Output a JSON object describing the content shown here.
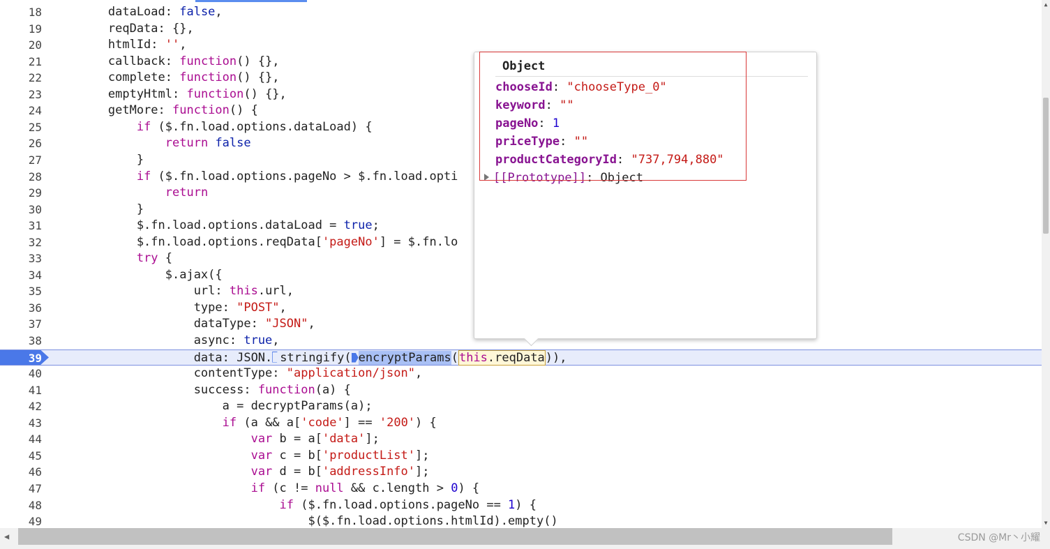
{
  "lines": [
    {
      "n": "18",
      "text": "        dataLoad: false,"
    },
    {
      "n": "19",
      "text": "        reqData: {},"
    },
    {
      "n": "20",
      "text": "        htmlId: '',"
    },
    {
      "n": "21",
      "text": "        callback: function() {},"
    },
    {
      "n": "22",
      "text": "        complete: function() {},"
    },
    {
      "n": "23",
      "text": "        emptyHtml: function() {},"
    },
    {
      "n": "24",
      "text": "        getMore: function() {"
    },
    {
      "n": "25",
      "text": "            if ($.fn.load.options.dataLoad) {"
    },
    {
      "n": "26",
      "text": "                return false"
    },
    {
      "n": "27",
      "text": "            }"
    },
    {
      "n": "28",
      "text": "            if ($.fn.load.options.pageNo > $.fn.load.opti"
    },
    {
      "n": "29",
      "text": "                return"
    },
    {
      "n": "30",
      "text": "            }"
    },
    {
      "n": "31",
      "text": "            $.fn.load.options.dataLoad = true;"
    },
    {
      "n": "32",
      "text": "            $.fn.load.options.reqData['pageNo'] = $.fn.lo"
    },
    {
      "n": "33",
      "text": "            try {"
    },
    {
      "n": "34",
      "text": "                $.ajax({"
    },
    {
      "n": "35",
      "text": "                    url: this.url,"
    },
    {
      "n": "36",
      "text": "                    type: \"POST\","
    },
    {
      "n": "37",
      "text": "                    dataType: \"JSON\","
    },
    {
      "n": "38",
      "text": "                    async: true,"
    },
    {
      "n": "39",
      "text": "                    data: JSON.stringify(encryptParams(this.reqData)),"
    },
    {
      "n": "40",
      "text": "                    contentType: \"application/json\","
    },
    {
      "n": "41",
      "text": "                    success: function(a) {"
    },
    {
      "n": "42",
      "text": "                        a = decryptParams(a);"
    },
    {
      "n": "43",
      "text": "                        if (a && a['code'] == '200') {"
    },
    {
      "n": "44",
      "text": "                            var b = a['data'];"
    },
    {
      "n": "45",
      "text": "                            var c = b['productList'];"
    },
    {
      "n": "46",
      "text": "                            var d = b['addressInfo'];"
    },
    {
      "n": "47",
      "text": "                            if (c != null && c.length > 0) {"
    },
    {
      "n": "48",
      "text": "                                if ($.fn.load.options.pageNo == 1) {"
    },
    {
      "n": "49",
      "text": "                                    $($.fn.load.options.htmlId).empty()"
    }
  ],
  "current_line": "39",
  "current_line_parts": {
    "prefix": "                    data: JSON.",
    "stringify": "stringify(",
    "encrypt": "encryptParams",
    "paren": "(",
    "this_req": "this.reqData",
    "suffix": ")),"
  },
  "popover": {
    "title": "Object",
    "props": [
      {
        "key": "chooseId",
        "sep": ": ",
        "value": "\"chooseType_0\"",
        "kind": "string"
      },
      {
        "key": "keyword",
        "sep": ": ",
        "value": "\"\"",
        "kind": "string"
      },
      {
        "key": "pageNo",
        "sep": ": ",
        "value": "1",
        "kind": "number"
      },
      {
        "key": "priceType",
        "sep": ": ",
        "value": "\"\"",
        "kind": "string"
      },
      {
        "key": "productCategoryId",
        "sep": ": ",
        "value": "\"737,794,880\"",
        "kind": "string"
      }
    ],
    "prototype": {
      "key": "[[Prototype]]",
      "sep": ": ",
      "value": "Object"
    }
  },
  "watermark": "CSDN @Mr丶小耀",
  "colors": {
    "keyword": "#aa0d91",
    "string": "#c41a16",
    "number": "#1c00cf",
    "current_line_bg": "#e7ecfb",
    "breakpoint": "#4a78e8",
    "annotation_box": "#d93838"
  }
}
